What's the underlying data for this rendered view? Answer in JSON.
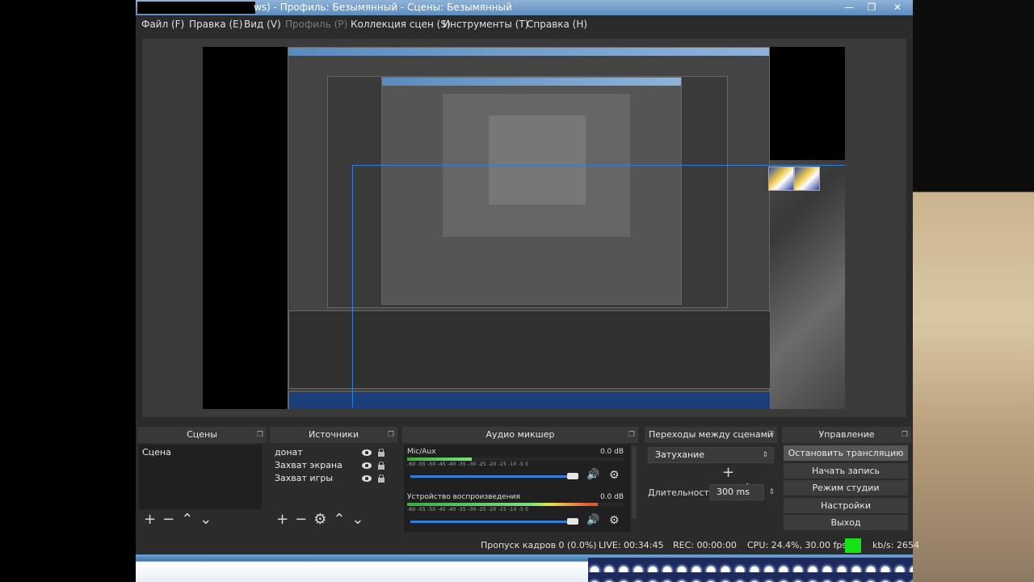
{
  "window": {
    "title": "ws) - Профиль: Безымянный - Сцены: Безымянный",
    "controls": [
      "—",
      "❐",
      "✕"
    ]
  },
  "menu": [
    {
      "label": "Файл (F)",
      "enabled": true
    },
    {
      "label": "Правка (E)",
      "enabled": true
    },
    {
      "label": "Вид (V)",
      "enabled": true
    },
    {
      "label": "Профиль (P)",
      "enabled": false
    },
    {
      "label": "Коллекция сцен (S)",
      "enabled": true
    },
    {
      "label": "Инструменты (T)",
      "enabled": true
    },
    {
      "label": "Справка (H)",
      "enabled": true
    }
  ],
  "docks": {
    "scenes": {
      "title": "Сцены",
      "items": [
        "Сцена"
      ]
    },
    "sources": {
      "title": "Источники",
      "items": [
        "донат",
        "Захват экрана",
        "Захват игры"
      ]
    },
    "mixer": {
      "title": "Аудио микшер",
      "scale": "-60  -55  -50  -45  -40  -35  -30  -25  -20  -15  -10   -5    0",
      "channels": [
        {
          "name": "Mic/Aux",
          "db": "0.0 dB",
          "level": 0.3
        },
        {
          "name": "Устройство воспроизведения",
          "db": "0.0 dB",
          "level": 0.88
        }
      ]
    },
    "transitions": {
      "title": "Переходы между сценами",
      "selected": "Затухание",
      "duration_label": "Длительность",
      "duration_value": "300 ms"
    },
    "controls": {
      "title": "Управление",
      "buttons": [
        "Остановить трансляцию",
        "Начать запись",
        "Режим студии",
        "Настройки",
        "Выход"
      ]
    }
  },
  "status": {
    "dropped": "Пропуск кадров 0 (0.0%)",
    "live": "LIVE: 00:34:45",
    "rec": "REC: 00:00:00",
    "cpu": "CPU: 24.4%, 30.00 fps",
    "kbs": "kb/s: 2654"
  },
  "colors": {
    "bg": "#2b2b2b",
    "dock_header": "#383838",
    "accent": "#2f7fd6",
    "live_indicator": "#16e316"
  }
}
